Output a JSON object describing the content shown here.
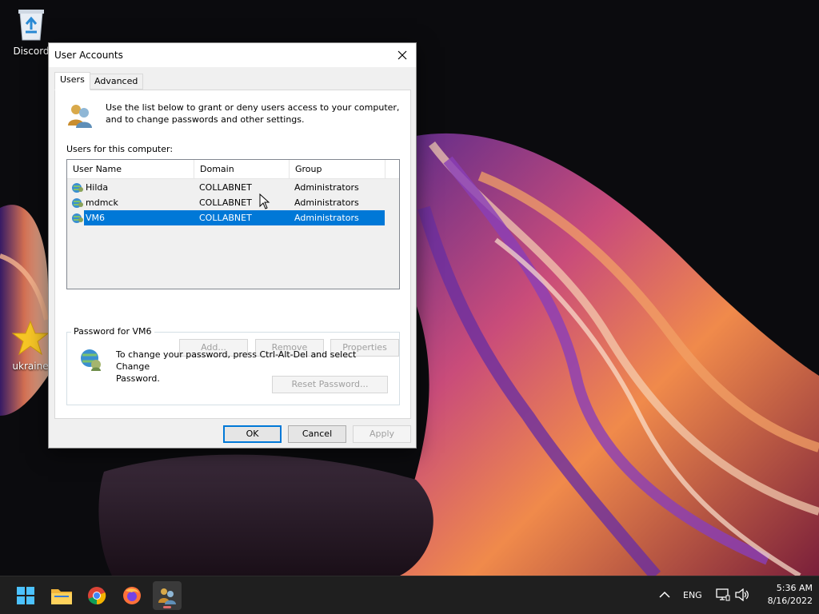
{
  "desktop": {
    "icons": [
      {
        "label": "Discord",
        "icon": "recycle-bin-icon"
      },
      {
        "label": "ukraine",
        "icon": "star-icon"
      }
    ]
  },
  "dialog": {
    "title": "User Accounts",
    "tabs": [
      {
        "label": "Users",
        "active": true
      },
      {
        "label": "Advanced",
        "active": false
      }
    ],
    "intro_text_1": "Use the list below to grant or deny users access to your computer,",
    "intro_text_2": "and to change passwords and other settings.",
    "list_label": "Users for this computer:",
    "columns": [
      "User Name",
      "Domain",
      "Group"
    ],
    "users": [
      {
        "name": "Hilda",
        "domain": "COLLABNET",
        "group": "Administrators",
        "selected": false
      },
      {
        "name": "mdmck",
        "domain": "COLLABNET",
        "group": "Administrators",
        "selected": false
      },
      {
        "name": "VM6",
        "domain": "COLLABNET",
        "group": "Administrators",
        "selected": true
      }
    ],
    "list_buttons": {
      "add": "Add...",
      "remove": "Remove",
      "properties": "Properties"
    },
    "password_group": {
      "legend": "Password for VM6",
      "text_1": "To change your password, press Ctrl-Alt-Del and select Change",
      "text_2": "Password.",
      "reset_button": "Reset Password..."
    },
    "footer_buttons": {
      "ok": "OK",
      "cancel": "Cancel",
      "apply": "Apply"
    }
  },
  "taskbar": {
    "apps": [
      "windows-start-icon",
      "file-explorer-icon",
      "chrome-icon",
      "firefox-icon",
      "user-accounts-icon"
    ],
    "tray": {
      "language": "ENG",
      "time": "5:36 AM",
      "date": "8/16/2022"
    }
  },
  "colors": {
    "selection": "#0078d7",
    "taskbar": "#1f1f1f"
  }
}
